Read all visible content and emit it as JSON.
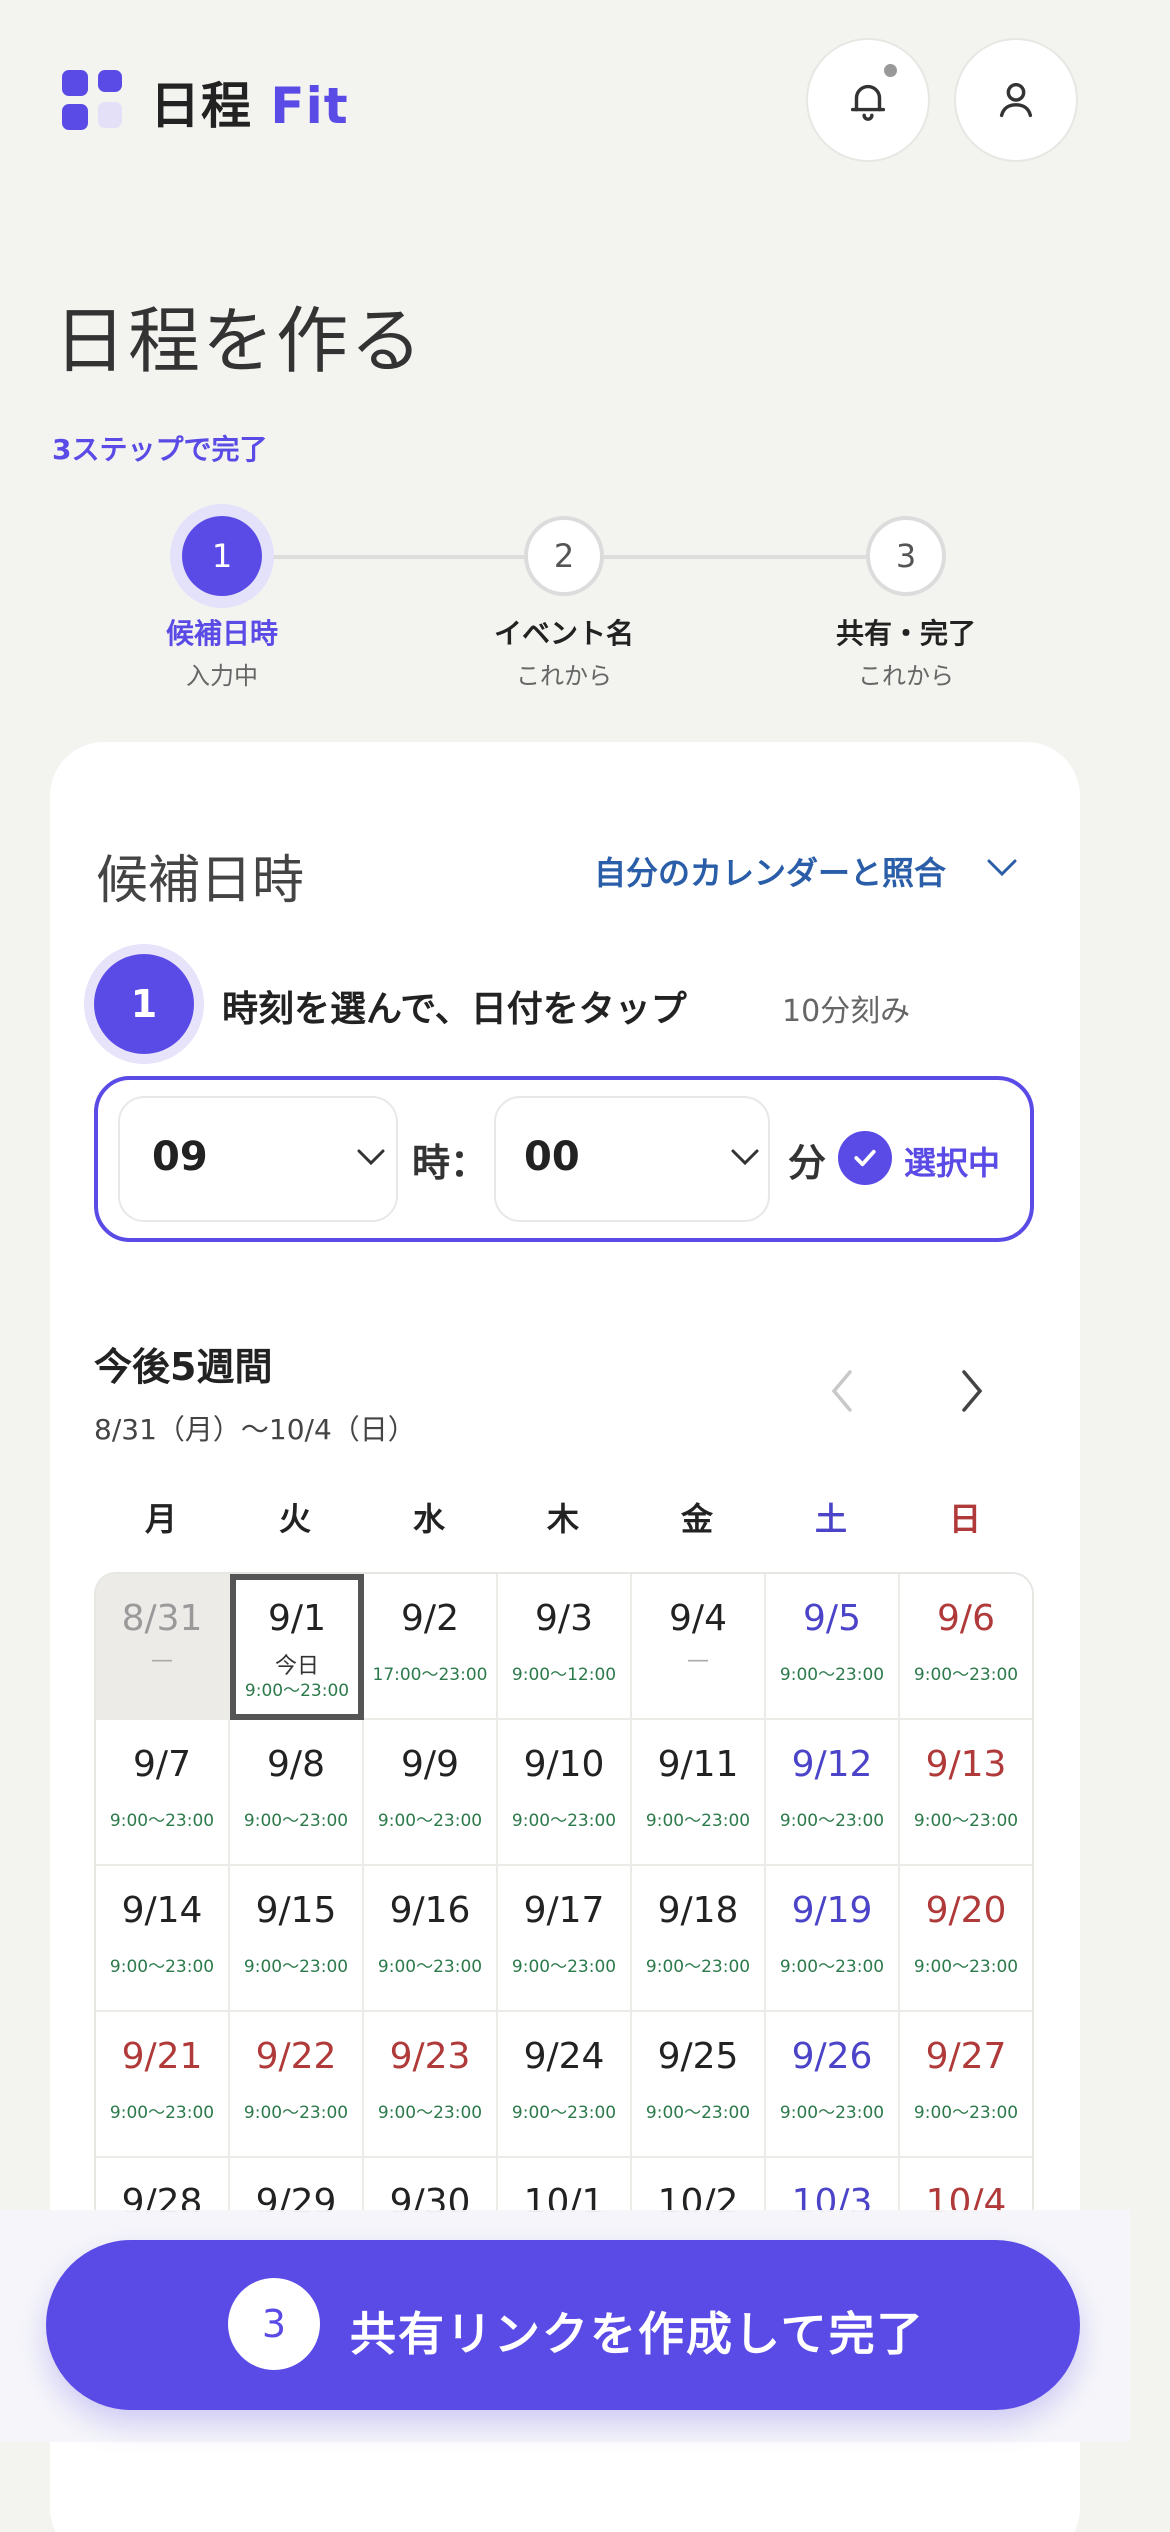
{
  "header": {
    "brand_main": "日程",
    "brand_accent": "Fit",
    "notification_icon": "bell-icon",
    "profile_icon": "user-icon"
  },
  "page": {
    "title": "日程を作る",
    "steps_caption": "3ステップで完了"
  },
  "stepper": [
    {
      "number": "1",
      "label": "候補日時",
      "status": "入力中",
      "active": true
    },
    {
      "number": "2",
      "label": "イベント名",
      "status": "これから",
      "active": false
    },
    {
      "number": "3",
      "label": "共有・完了",
      "status": "これから",
      "active": false
    }
  ],
  "card": {
    "title": "候補日時",
    "calendar_sync_label": "自分のカレンダーと照合",
    "substep_number": "1",
    "substep_text": "時刻を選んで、日付をタップ",
    "substep_hint": "10分刻み"
  },
  "time_picker": {
    "hour_value": "09",
    "hour_unit": "時：",
    "minute_value": "00",
    "minute_unit": "分",
    "selected_label": "選択中"
  },
  "period": {
    "title": "今後5週間",
    "range": "8/31（月）〜10/4（日）"
  },
  "weekdays": [
    "月",
    "火",
    "水",
    "木",
    "金",
    "土",
    "日"
  ],
  "calendar": {
    "rows": [
      [
        {
          "date": "8/31",
          "note": "—",
          "kind": "past"
        },
        {
          "date": "9/1",
          "tag": "今日",
          "time": "9:00〜23:00",
          "kind": "today"
        },
        {
          "date": "9/2",
          "time": "17:00〜23:00",
          "kind": "weekday"
        },
        {
          "date": "9/3",
          "time": "9:00〜12:00",
          "kind": "weekday"
        },
        {
          "date": "9/4",
          "note": "—",
          "kind": "weekday"
        },
        {
          "date": "9/5",
          "time": "9:00〜23:00",
          "kind": "sat"
        },
        {
          "date": "9/6",
          "time": "9:00〜23:00",
          "kind": "sun"
        }
      ],
      [
        {
          "date": "9/7",
          "time": "9:00〜23:00",
          "kind": "weekday"
        },
        {
          "date": "9/8",
          "time": "9:00〜23:00",
          "kind": "weekday"
        },
        {
          "date": "9/9",
          "time": "9:00〜23:00",
          "kind": "weekday"
        },
        {
          "date": "9/10",
          "time": "9:00〜23:00",
          "kind": "weekday"
        },
        {
          "date": "9/11",
          "time": "9:00〜23:00",
          "kind": "weekday"
        },
        {
          "date": "9/12",
          "time": "9:00〜23:00",
          "kind": "sat"
        },
        {
          "date": "9/13",
          "time": "9:00〜23:00",
          "kind": "sun"
        }
      ],
      [
        {
          "date": "9/14",
          "time": "9:00〜23:00",
          "kind": "weekday"
        },
        {
          "date": "9/15",
          "time": "9:00〜23:00",
          "kind": "weekday"
        },
        {
          "date": "9/16",
          "time": "9:00〜23:00",
          "kind": "weekday"
        },
        {
          "date": "9/17",
          "time": "9:00〜23:00",
          "kind": "weekday"
        },
        {
          "date": "9/18",
          "time": "9:00〜23:00",
          "kind": "weekday"
        },
        {
          "date": "9/19",
          "time": "9:00〜23:00",
          "kind": "sat"
        },
        {
          "date": "9/20",
          "time": "9:00〜23:00",
          "kind": "sun"
        }
      ],
      [
        {
          "date": "9/21",
          "time": "9:00〜23:00",
          "kind": "sun"
        },
        {
          "date": "9/22",
          "time": "9:00〜23:00",
          "kind": "sun"
        },
        {
          "date": "9/23",
          "time": "9:00〜23:00",
          "kind": "sun"
        },
        {
          "date": "9/24",
          "time": "9:00〜23:00",
          "kind": "weekday"
        },
        {
          "date": "9/25",
          "time": "9:00〜23:00",
          "kind": "weekday"
        },
        {
          "date": "9/26",
          "time": "9:00〜23:00",
          "kind": "sat"
        },
        {
          "date": "9/27",
          "time": "9:00〜23:00",
          "kind": "sun"
        }
      ],
      [
        {
          "date": "9/28",
          "kind": "weekday"
        },
        {
          "date": "9/29",
          "kind": "weekday"
        },
        {
          "date": "9/30",
          "kind": "weekday"
        },
        {
          "date": "10/1",
          "kind": "weekday"
        },
        {
          "date": "10/2",
          "kind": "weekday"
        },
        {
          "date": "10/3",
          "kind": "sat"
        },
        {
          "date": "10/4",
          "kind": "sun"
        }
      ]
    ]
  },
  "cta": {
    "number": "3",
    "label": "共有リンクを作成して完了"
  },
  "colors": {
    "accent": "#5b4be6",
    "saturday": "#4b44c8",
    "holiday": "#b03a3a",
    "available_time": "#2c7a4b",
    "sync_link": "#2b5ea8"
  }
}
